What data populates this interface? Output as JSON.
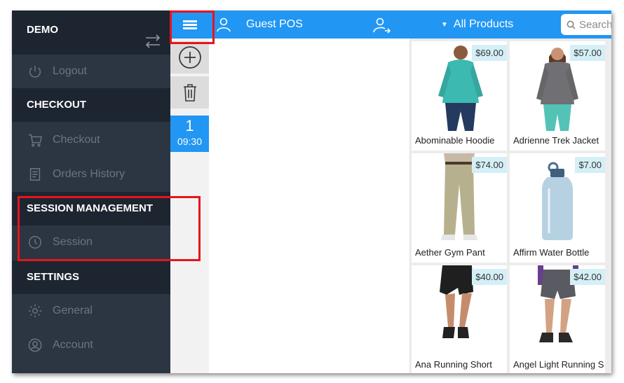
{
  "sidebar": {
    "store_name": "DEMO",
    "logout_label": "Logout",
    "sections": {
      "checkout": "CHECKOUT",
      "session_management": "SESSION MANAGEMENT",
      "settings": "SETTINGS"
    },
    "items": {
      "checkout": "Checkout",
      "orders_history": "Orders History",
      "session": "Session",
      "general": "General",
      "account": "Account"
    }
  },
  "order_tab": {
    "number": "1",
    "time": "09:30"
  },
  "topbar": {
    "customer": "Guest POS",
    "category_filter": "All Products",
    "search_placeholder": "Search"
  },
  "products": [
    {
      "name": "Abominable Hoodie",
      "price": "$69.00"
    },
    {
      "name": "Adrienne Trek Jacket",
      "price": "$57.00"
    },
    {
      "name": "Aether Gym Pant",
      "price": "$74.00"
    },
    {
      "name": "Affirm Water Bottle",
      "price": "$7.00"
    },
    {
      "name": "Ana Running Short",
      "price": "$40.00"
    },
    {
      "name": "Angel Light Running S",
      "price": "$42.00"
    }
  ],
  "colors": {
    "accent": "#2196f3",
    "sidebar_bg": "#2c3542",
    "sidebar_header_bg": "#1d2530",
    "price_badge_bg": "#d4eff6",
    "annotation": "#e8141c"
  }
}
